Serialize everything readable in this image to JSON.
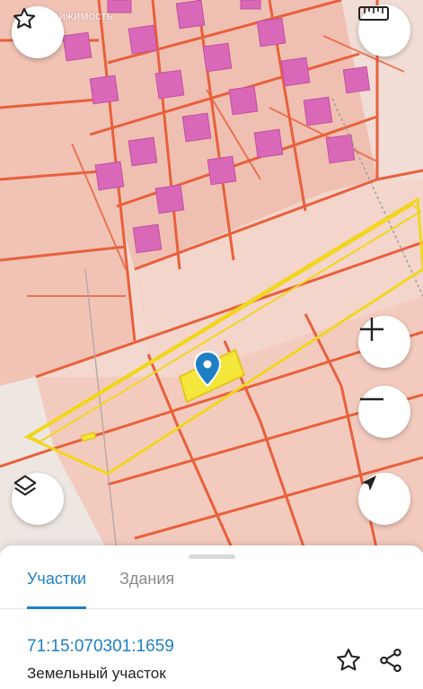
{
  "map": {
    "watermark": "Недвижимость",
    "colors": {
      "parcel_fill": "#f3c9bd",
      "parcel_stroke": "#e8603c",
      "building_fill": "#d968b8",
      "selected_stroke": "#f1d61d",
      "selected_fill": "#f5e63b",
      "pin": "#1f7fc4"
    },
    "icons": [
      "star-icon",
      "ruler-icon",
      "layers-icon",
      "zoom-in-icon",
      "zoom-out-icon",
      "location-arrow-icon",
      "map-pin-icon"
    ]
  },
  "sheet": {
    "tabs": [
      {
        "label": "Участки",
        "active": true
      },
      {
        "label": "Здания",
        "active": false
      }
    ],
    "parcel": {
      "cadastral_number": "71:15:070301:1659",
      "type": "Земельный участок"
    },
    "icons": [
      "star-outline-icon",
      "share-icon"
    ]
  }
}
